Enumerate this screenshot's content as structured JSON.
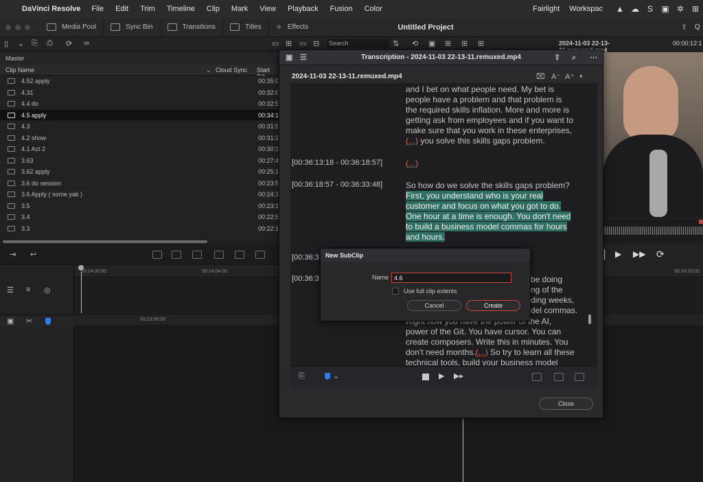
{
  "menubar": {
    "app_name": "DaVinci Resolve",
    "items": [
      "File",
      "Edit",
      "Trim",
      "Timeline",
      "Clip",
      "Mark",
      "View",
      "Playback",
      "Fusion",
      "Color"
    ],
    "right_items": [
      "Fairlight",
      "Workspac"
    ]
  },
  "toolbar": {
    "media_pool": "Media Pool",
    "sync_bin": "Sync Bin",
    "transitions": "Transitions",
    "titles": "Titles",
    "effects": "Effects",
    "project_title": "Untitled Project",
    "right_label": "Q"
  },
  "pool": {
    "search_placeholder": "Search",
    "bin": "Master",
    "col_clip_name": "Clip Name",
    "col_cloud_sync": "Cloud Sync",
    "col_start_tc": "Start TC",
    "clips": [
      {
        "name": "4.52 apply",
        "tc": "00:35:0"
      },
      {
        "name": "4.31",
        "tc": "00:32:0"
      },
      {
        "name": "4.4 do",
        "tc": "00:32:5"
      },
      {
        "name": "4.5 apply",
        "tc": "00:34:1"
      },
      {
        "name": "4.3",
        "tc": "00:31:5"
      },
      {
        "name": "4.2 show",
        "tc": "00:31:2"
      },
      {
        "name": "4.1 Act 2",
        "tc": "00:30:3"
      },
      {
        "name": "3.63",
        "tc": "00:27:4"
      },
      {
        "name": "3.62 apply",
        "tc": "00:25:1"
      },
      {
        "name": "3.6 do session",
        "tc": "00:23:5"
      },
      {
        "name": "3.6 Apply ( some yak )",
        "tc": "00:24:3"
      },
      {
        "name": "3.5",
        "tc": "00:23:1"
      },
      {
        "name": "3.4",
        "tc": "00:22:5"
      },
      {
        "name": "3.3",
        "tc": "00:22:1"
      }
    ],
    "selected_clip": "4.5 apply"
  },
  "viewer": {
    "filename": "2024-11-03 22-13-11.remuxed.mp4",
    "timecode": "00:00:12:1"
  },
  "timeline": {
    "ruler_tc_1": "00:24:00:00",
    "ruler_tc_2": "00:24:04:00",
    "ruler_tc_3": "00:24:20:00",
    "ruler2_tc": "00:23:56:00"
  },
  "transcription": {
    "title": "Transcription - 2024-11-03 22-13-11.remuxed.mp4",
    "filename": "2024-11-03 22-13-11.remuxed.mp4",
    "para1": [
      "and I bet on what people need. My bet is",
      "people have a problem and that problem is",
      "the required skills inflation. More and more is",
      "getting ask from employees and if you want to",
      "make sure that you work in these enterprises,"
    ],
    "para1_pause": "(...)",
    "para1_last": " you solve this skills gaps problem.",
    "ts2": "[00:36:13:18 - 00:36:18:57]",
    "para2_pause": "(...)",
    "ts3": "[00:36:18:57 - 00:36:33:48]",
    "para3_first": "So how do we solve the skills gaps problem?",
    "para3_hl": [
      "First, you understand who is your real",
      "customer and focus on what you got to do.",
      "One hour at a time is enough. You don't need",
      "to build a business model commas for hours",
      "and hours."
    ],
    "ts4_partial": "[00:36:3",
    "ts5_partial": "[00:36:3",
    "para4": [
      "be doing",
      "ng of the",
      "ding weeks,",
      "del commas."
    ],
    "para5": [
      "Right now you have the power of the AI,",
      "power of the Git. You have cursor. You can",
      "create composers. Write this in minutes. You",
      "don't need months."
    ],
    "para5_pause": "(...)",
    "para5_tail": " So try to learn all these",
    "para5_last": "technical tools, build your business model",
    "close": "Close"
  },
  "subclip": {
    "title": "New SubClip",
    "name_label": "Name",
    "name_value": "4.6",
    "use_full_clip": "Use full clip extents",
    "cancel": "Cancel",
    "create": "Create"
  },
  "colors": {
    "highlight": "#2f6f62",
    "accent_red": "#d0433b",
    "flag_blue": "#2f7bf0"
  }
}
